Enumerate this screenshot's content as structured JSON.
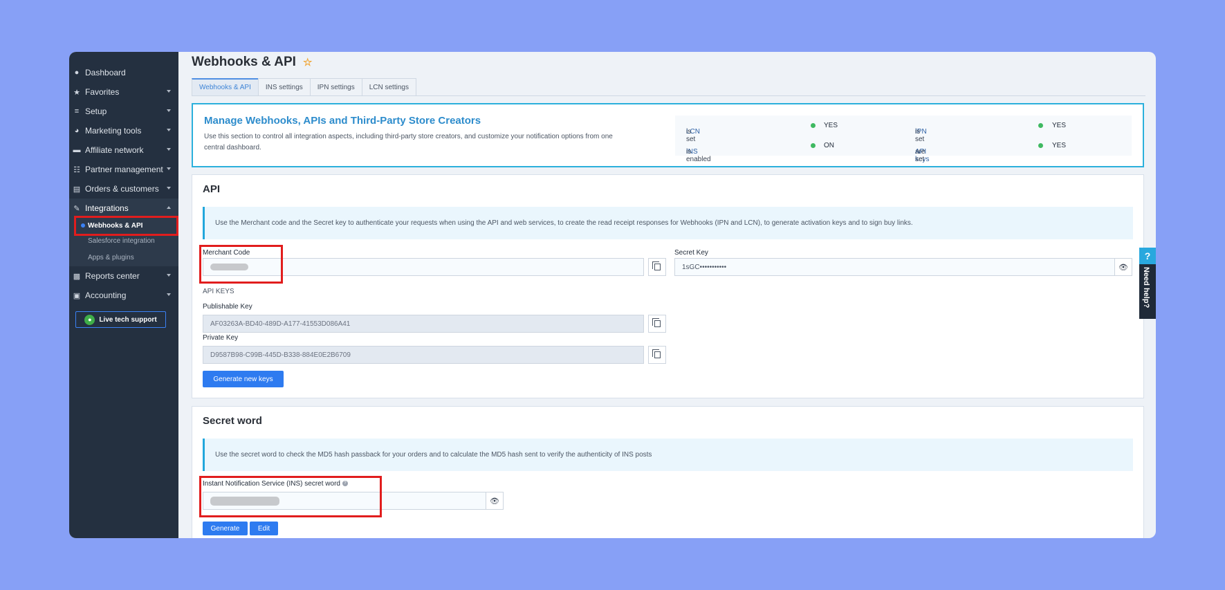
{
  "sidebar": {
    "items": [
      {
        "label": "Dashboard",
        "icon": "dashboard-icon"
      },
      {
        "label": "Favorites",
        "icon": "star-icon"
      },
      {
        "label": "Setup",
        "icon": "sliders-icon"
      },
      {
        "label": "Marketing tools",
        "icon": "pie-chart-icon"
      },
      {
        "label": "Affiliate network",
        "icon": "handshake-icon"
      },
      {
        "label": "Partner management",
        "icon": "sitemap-icon"
      },
      {
        "label": "Orders & customers",
        "icon": "clipboard-icon"
      },
      {
        "label": "Integrations",
        "icon": "plug-icon"
      },
      {
        "label": "Reports center",
        "icon": "bar-chart-icon"
      },
      {
        "label": "Accounting",
        "icon": "building-icon"
      }
    ],
    "integrations_sub": [
      {
        "label": "Webhooks & API"
      },
      {
        "label": "Salesforce integration"
      },
      {
        "label": "Apps & plugins"
      }
    ],
    "live_support": "Live tech support"
  },
  "page": {
    "title": "Webhooks & API",
    "tabs": [
      "Webhooks & API",
      "INS settings",
      "IPN settings",
      "LCN settings"
    ]
  },
  "intro": {
    "title": "Manage Webhooks, APIs and Third-Party Store Creators",
    "description": "Use this section to control all integration aspects, including third-party store creators, and customize your notification options from one central dashboard.",
    "status": [
      {
        "key": "LCN",
        "suffix": " is set",
        "value": "YES",
        "color": "#3fb961"
      },
      {
        "key": "IPN",
        "suffix": " is set",
        "value": "YES",
        "color": "#3fb961"
      },
      {
        "key": "INS",
        "suffix": " is enabled",
        "value": "ON",
        "color": "#3fb961"
      },
      {
        "key": "API keys",
        "suffix": " are set",
        "value": "YES",
        "color": "#3fb961"
      }
    ]
  },
  "api": {
    "title": "API",
    "info": "Use the Merchant code and the Secret key to authenticate your requests when using the API and web services, to create the read receipt responses for Webhooks (IPN and LCN), to generate activation keys and to sign buy links.",
    "merchant_code_label": "Merchant Code",
    "secret_key_label": "Secret Key",
    "secret_key_value": "1sGC•••••••••••",
    "api_keys_heading": "API KEYS",
    "publishable_key_label": "Publishable Key",
    "publishable_key_value": "AF03263A-BD40-489D-A177-41553D086A41",
    "private_key_label": "Private Key",
    "private_key_value": "D9587B98-C99B-445D-B338-884E0E2B6709",
    "generate_keys_label": "Generate new keys"
  },
  "secret_word": {
    "title": "Secret word",
    "info": "Use the secret word to check the MD5 hash passback for your orders and to calculate the MD5 hash sent to verify the authenticity of INS posts",
    "ins_label": "Instant Notification Service (INS) secret word",
    "generate_label": "Generate",
    "edit_label": "Edit"
  },
  "need_help": {
    "label": "Need help?",
    "icon": "?"
  }
}
